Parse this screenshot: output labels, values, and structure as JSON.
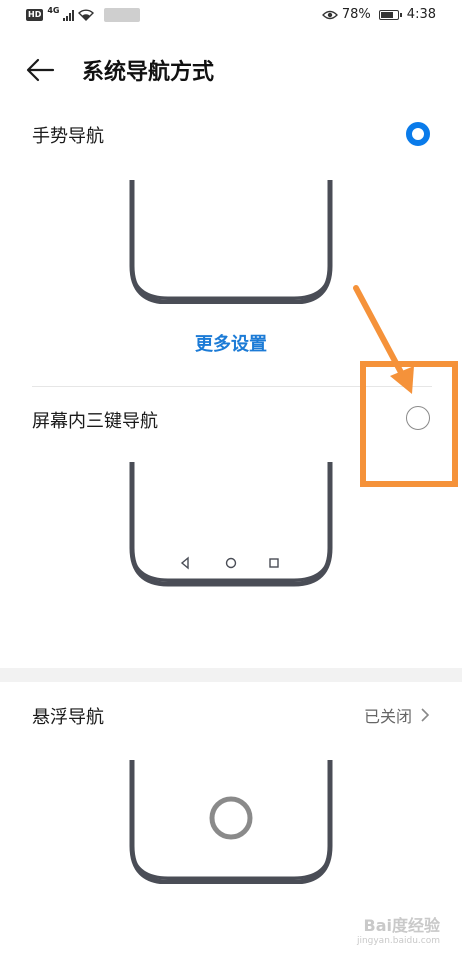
{
  "status_bar": {
    "hd": "HD",
    "network": "4G",
    "battery_percent": "78%",
    "battery_level": 0.78,
    "time": "4:38"
  },
  "header": {
    "title": "系统导航方式",
    "back_icon": "arrow-left-icon"
  },
  "options": {
    "gesture": {
      "label": "手势导航",
      "selected": true
    },
    "more_settings": "更多设置",
    "three_key": {
      "label": "屏幕内三键导航",
      "selected": false
    },
    "floating": {
      "label": "悬浮导航",
      "status": "已关闭"
    }
  },
  "colors": {
    "accent": "#0a7bea",
    "link": "#1c7bd6",
    "annotation": "#f5923a",
    "phone_frame": "#4a4d56"
  },
  "watermark": {
    "main": "Bai度经验",
    "sub": "jingyan.baidu.com"
  }
}
